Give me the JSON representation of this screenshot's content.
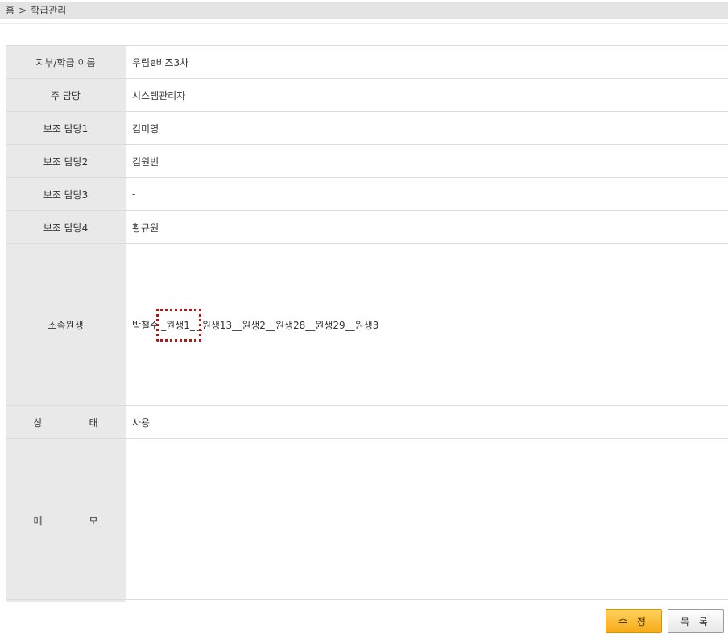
{
  "breadcrumb": {
    "home": "홈",
    "separator": ">",
    "current": "학급관리"
  },
  "detail": {
    "rows": [
      {
        "label": "지부/학급 이름",
        "value": "우림e비즈3차"
      },
      {
        "label": "주 담당",
        "value": "시스템관리자"
      },
      {
        "label": "보조 담당1",
        "value": "김미영"
      },
      {
        "label": "보조 담당2",
        "value": "김원빈"
      },
      {
        "label": "보조 담당3",
        "value": "-"
      },
      {
        "label": "보조 담당4",
        "value": "황규원"
      }
    ],
    "students": {
      "label": "소속원생",
      "first": "박철수",
      "highlighted": "_원생1_",
      "rest": "_원생13__원생2__원생28__원생29__원생3"
    },
    "status": {
      "label_a": "상",
      "label_b": "태",
      "value": "사용"
    },
    "memo": {
      "label_a": "메",
      "label_b": "모",
      "value": ""
    }
  },
  "buttons": {
    "edit": "수 정",
    "list": "목 록"
  },
  "colors": {
    "label_bg": "#e9e9e9",
    "edit_button": "#f6aa18",
    "highlight_border": "#b31414"
  }
}
